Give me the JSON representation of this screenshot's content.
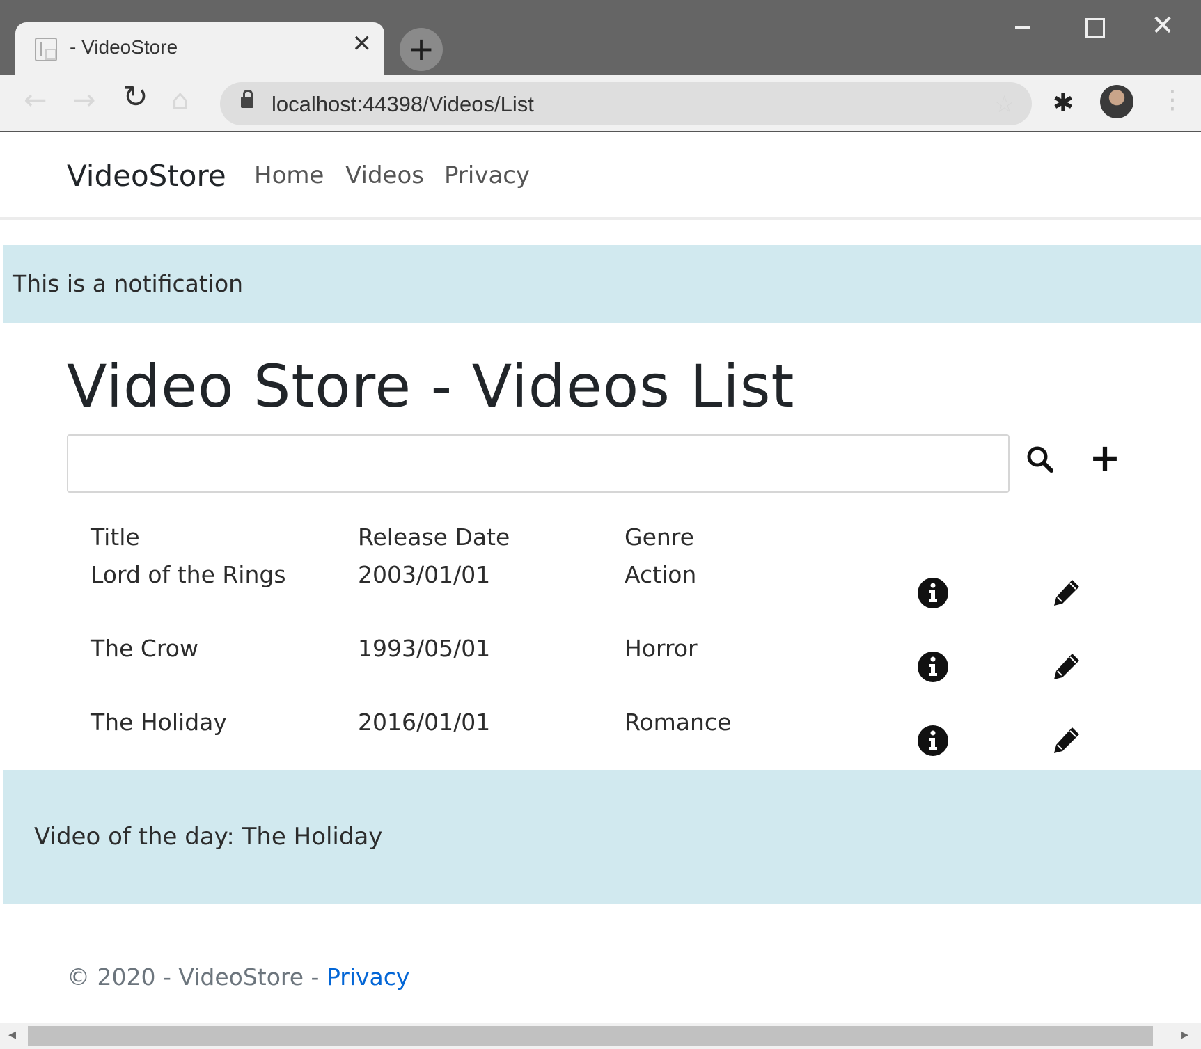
{
  "browser": {
    "tab_title": "- VideoStore",
    "url": "localhost:44398/Videos/List"
  },
  "navbar": {
    "brand": "VideoStore",
    "links": [
      "Home",
      "Videos",
      "Privacy"
    ]
  },
  "notification": "This is a notification",
  "page_title": "Video Store - Videos List",
  "search": {
    "value": "",
    "placeholder": ""
  },
  "table": {
    "headers": [
      "Title",
      "Release Date",
      "Genre"
    ],
    "rows": [
      {
        "title": "Lord of the Rings",
        "release_date": "2003/01/01",
        "genre": "Action"
      },
      {
        "title": "The Crow",
        "release_date": "1993/05/01",
        "genre": "Horror"
      },
      {
        "title": "The Holiday",
        "release_date": "2016/01/01",
        "genre": "Romance"
      }
    ]
  },
  "video_of_the_day": "Video of the day: The Holiday",
  "footer": {
    "text": "© 2020 - VideoStore - ",
    "privacy_link": "Privacy"
  },
  "icons": {
    "search": "search-icon",
    "add": "plus-icon",
    "info": "info-circle-icon",
    "edit": "pencil-icon"
  },
  "colors": {
    "notification_bg": "#d1e9ef",
    "titlebar_bg": "#656565",
    "link": "#0366d6"
  }
}
